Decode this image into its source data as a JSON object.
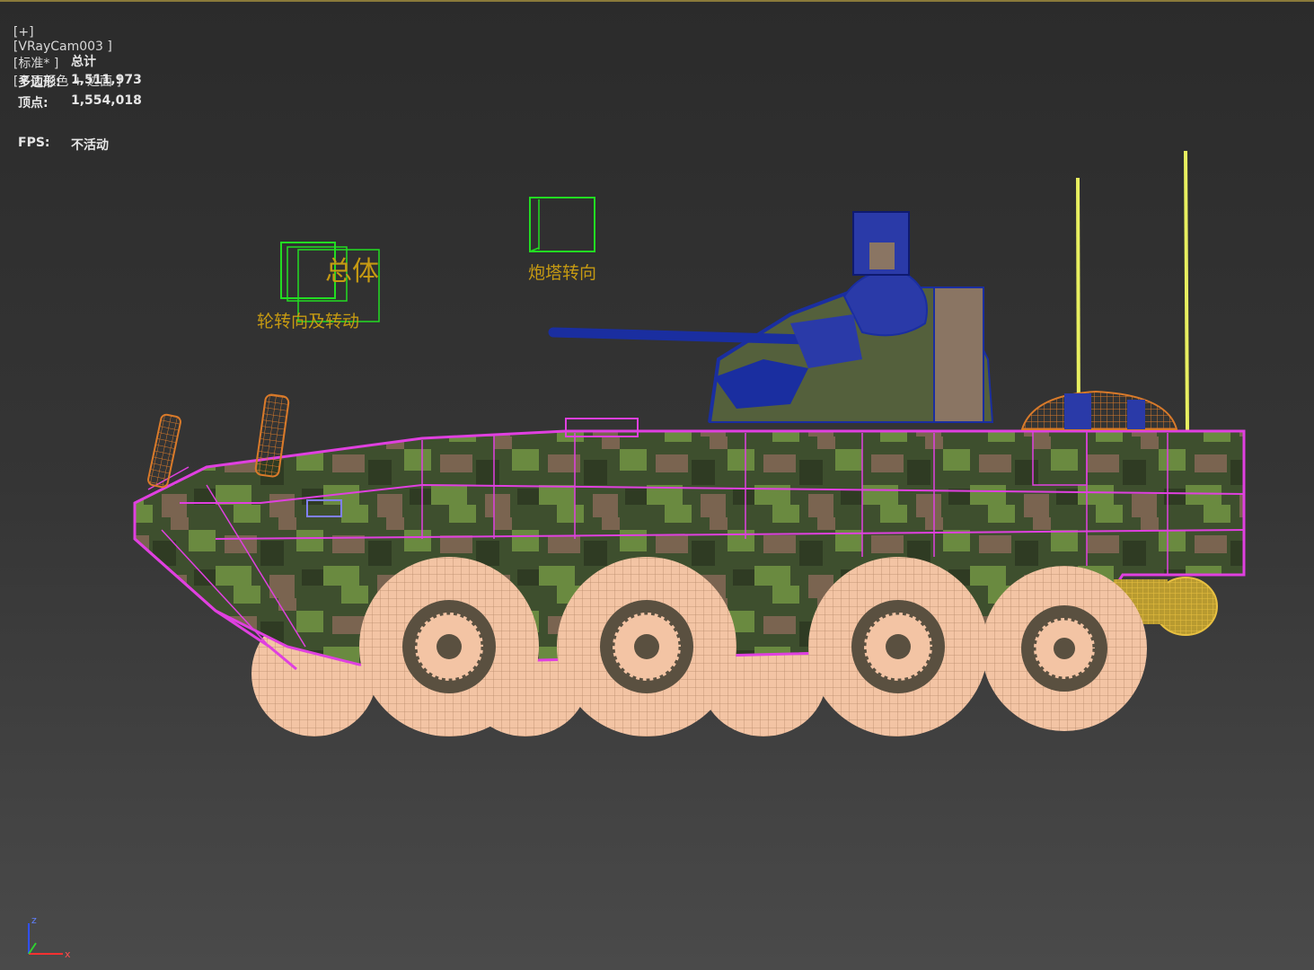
{
  "viewport": {
    "plus": "[+]",
    "camera": "[VRayCam003 ]",
    "mode": "[标准* ]",
    "shading": "[平面颜色 + 边面 ]"
  },
  "stats": {
    "heading": "总计",
    "polygons_label": "多边形:",
    "polygons_value": "1,511,973",
    "vertices_label": "顶点:",
    "vertices_value": "1,554,018",
    "fps_label": "FPS:",
    "fps_value": "不活动"
  },
  "helpers": {
    "body": "总体",
    "wheels": "轮转向及转动",
    "turret": "炮塔转向"
  },
  "axis": {
    "z": "z",
    "x": "x"
  },
  "colors": {
    "body_wire": "#e040e0",
    "turret": "#1a2ea0",
    "wheel": "#f3c4a4",
    "helper_box": "#22dd22",
    "helper_text": "#c69a12",
    "antenna": "#e8ef60",
    "orange_part": "#d97a2a",
    "camo_green": "#5f7a3c",
    "camo_dark": "#3a4a2c",
    "camo_brown": "#7a6450"
  }
}
